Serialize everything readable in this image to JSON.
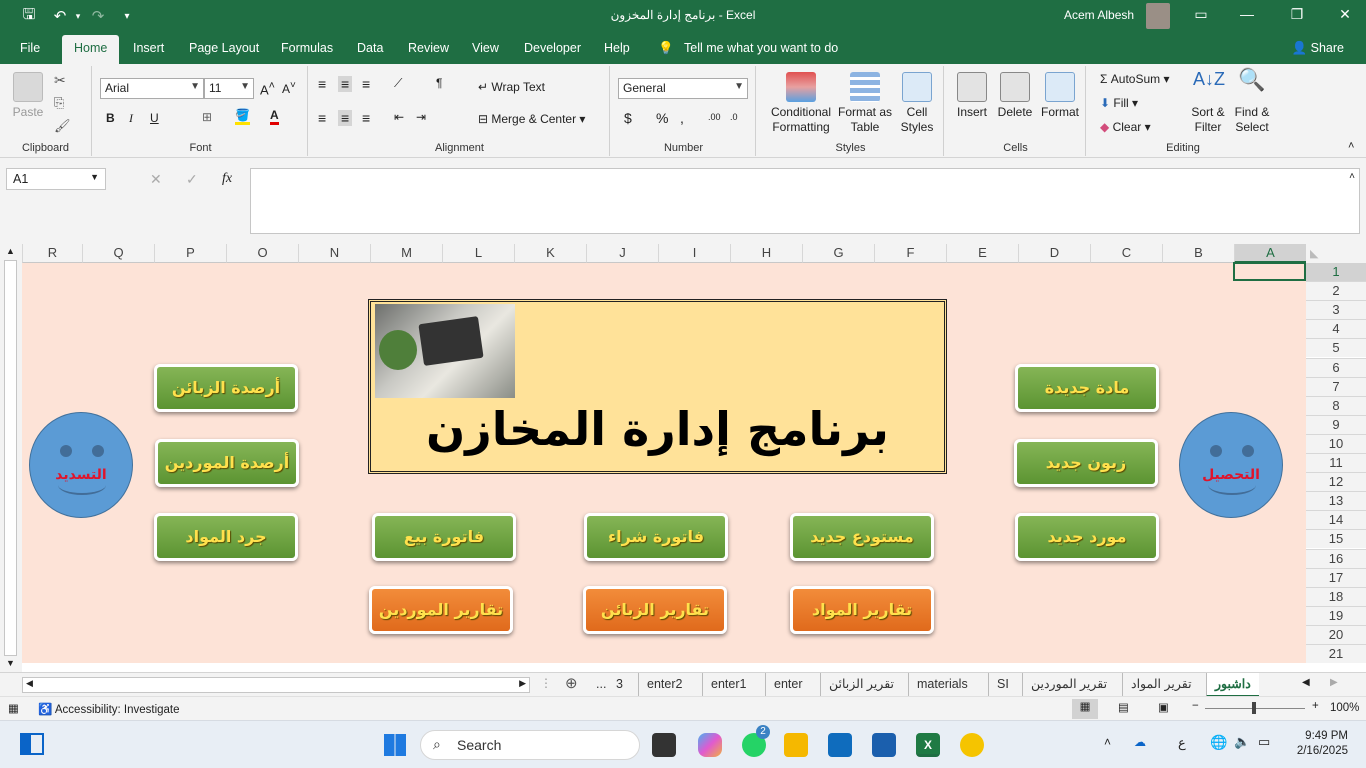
{
  "window": {
    "title": "برنامج إدارة المخزون  -  Excel",
    "user": "Acem Albesh"
  },
  "tabs": [
    "File",
    "Home",
    "Insert",
    "Page Layout",
    "Formulas",
    "Data",
    "Review",
    "View",
    "Developer",
    "Help"
  ],
  "tell_me": "Tell me what you want to do",
  "share": "Share",
  "ribbon": {
    "clipboard": {
      "paste": "Paste",
      "label": "Clipboard"
    },
    "font": {
      "name": "Arial",
      "size": "11",
      "label": "Font"
    },
    "alignment": {
      "wrap": "Wrap Text",
      "merge": "Merge & Center",
      "label": "Alignment"
    },
    "number": {
      "format": "General",
      "label": "Number"
    },
    "styles": {
      "cond1": "Conditional",
      "cond2": "Formatting",
      "fmt1": "Format as",
      "fmt2": "Table",
      "cell1": "Cell",
      "cell2": "Styles",
      "label": "Styles"
    },
    "cells": {
      "insert": "Insert",
      "delete": "Delete",
      "format": "Format",
      "label": "Cells"
    },
    "editing": {
      "autosum": "AutoSum",
      "fill": "Fill",
      "clear": "Clear",
      "sort1": "Sort &",
      "sort2": "Filter",
      "find1": "Find &",
      "find2": "Select",
      "label": "Editing"
    }
  },
  "formula_bar": {
    "name_box": "A1",
    "fx": "fx",
    "content": ""
  },
  "columns": [
    "R",
    "Q",
    "P",
    "O",
    "N",
    "M",
    "L",
    "K",
    "J",
    "I",
    "H",
    "G",
    "F",
    "E",
    "D",
    "C",
    "B",
    "A"
  ],
  "rows": [
    "1",
    "2",
    "3",
    "4",
    "5",
    "6",
    "7",
    "8",
    "9",
    "10",
    "11",
    "12",
    "13",
    "14",
    "15",
    "16",
    "17",
    "18",
    "19",
    "20",
    "21"
  ],
  "dashboard": {
    "title": "برنامج إدارة المخازن",
    "buttons": {
      "new_material": "مادة جديدة",
      "new_customer": "زبون جديد",
      "new_supplier": "مورد جديد",
      "new_warehouse": "مستودع جديد",
      "purchase_invoice": "فاتورة شراء",
      "sales_invoice": "فاتورة بيع",
      "inventory": "جرد المواد",
      "customer_balances": "أرصدة الزبائن",
      "supplier_balances": "أرصدة الموردين",
      "materials_reports": "تقارير المواد",
      "customers_reports": "تقارير الزبائن",
      "suppliers_reports": "تقارير الموردين"
    },
    "collection_face": "التحصيل",
    "payment_face": "التسديد"
  },
  "sheet_tabs": [
    "3",
    "...",
    "enter2",
    "enter1",
    "enter",
    "تقرير الزبائن",
    "materials",
    "SI",
    "تقرير الموردين",
    "تقرير المواد",
    "داشبور"
  ],
  "status": {
    "accessibility": "Accessibility: Investigate",
    "zoom": "100%"
  },
  "taskbar": {
    "search": "Search",
    "time": "9:49 PM",
    "date": "2/16/2025",
    "lang": "ع",
    "badge": "2"
  }
}
